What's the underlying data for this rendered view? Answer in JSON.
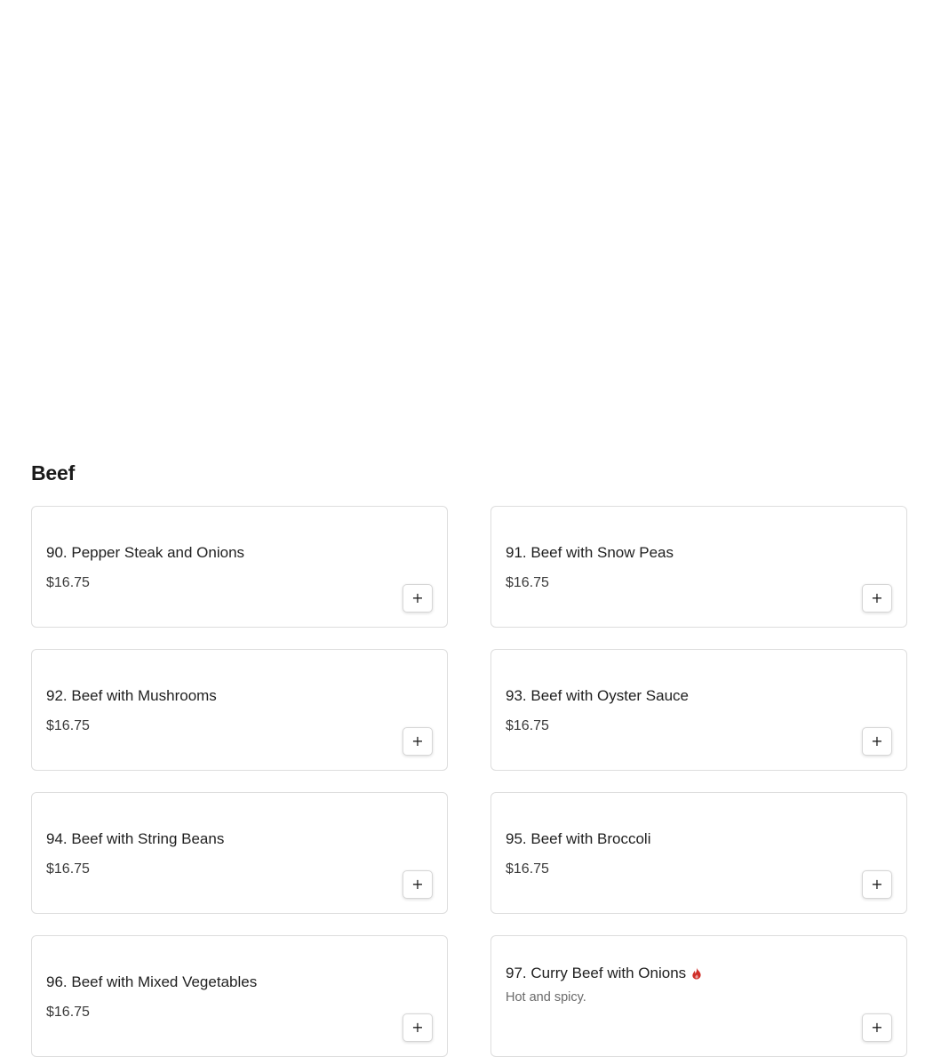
{
  "section": {
    "title": "Beef"
  },
  "add_button": {
    "symbol": "+",
    "aria_label": "Add to order"
  },
  "items": [
    {
      "name": "90. Pepper Steak and Onions",
      "price": "$16.75"
    },
    {
      "name": "91. Beef with Snow Peas",
      "price": "$16.75"
    },
    {
      "name": "92. Beef with Mushrooms",
      "price": "$16.75"
    },
    {
      "name": "93. Beef with Oyster Sauce",
      "price": "$16.75"
    },
    {
      "name": "94. Beef with String Beans",
      "price": "$16.75"
    },
    {
      "name": "95. Beef with Broccoli",
      "price": "$16.75"
    },
    {
      "name": "96. Beef with Mixed Vegetables",
      "price": "$16.75"
    },
    {
      "name": "97. Curry Beef with Onions",
      "description": "Hot and spicy.",
      "price": "",
      "icon": "spicy-icon",
      "icon_color": "#d0302a"
    }
  ]
}
